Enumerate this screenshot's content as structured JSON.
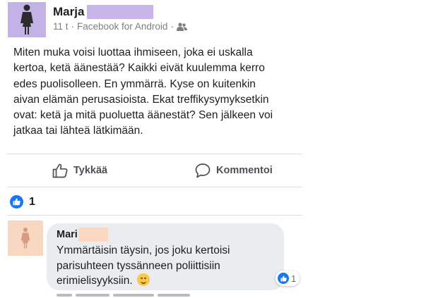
{
  "post": {
    "author": "Marja",
    "time": "11 t",
    "separator": "·",
    "source": "Facebook for Android",
    "audience_icon": "friends-icon",
    "text": "Miten muka voisi luottaa ihmiseen, joka ei uskalla\nkertoa, ketä äänestää? Kaikki eivät kuulemma kerro\nedes puolisolleen. En ymmärrä. Kyse on kuitenkin\naivan elämän perusasioista. Ekat treffikysymyksetkin\novat: ketä ja mitä puoluetta äänestät? Sen jälkeen voi\njatkaa tai lähteä lätkimään."
  },
  "actions": {
    "like_label": "Tykkää",
    "comment_label": "Kommentoi"
  },
  "reactions": {
    "count": "1"
  },
  "comment": {
    "author": "Mari",
    "text": "Ymmärtäisin täysin, jos joku kertoisi\nparisuhteen tyssänneen poliittisiin\nerimielisyyksiin.",
    "reaction_count": "1"
  },
  "colors": {
    "accent": "#1877f2",
    "post_avatar": "#c3b2e6",
    "comment_avatar": "#f8d7c1",
    "bubble": "#eaecef"
  }
}
